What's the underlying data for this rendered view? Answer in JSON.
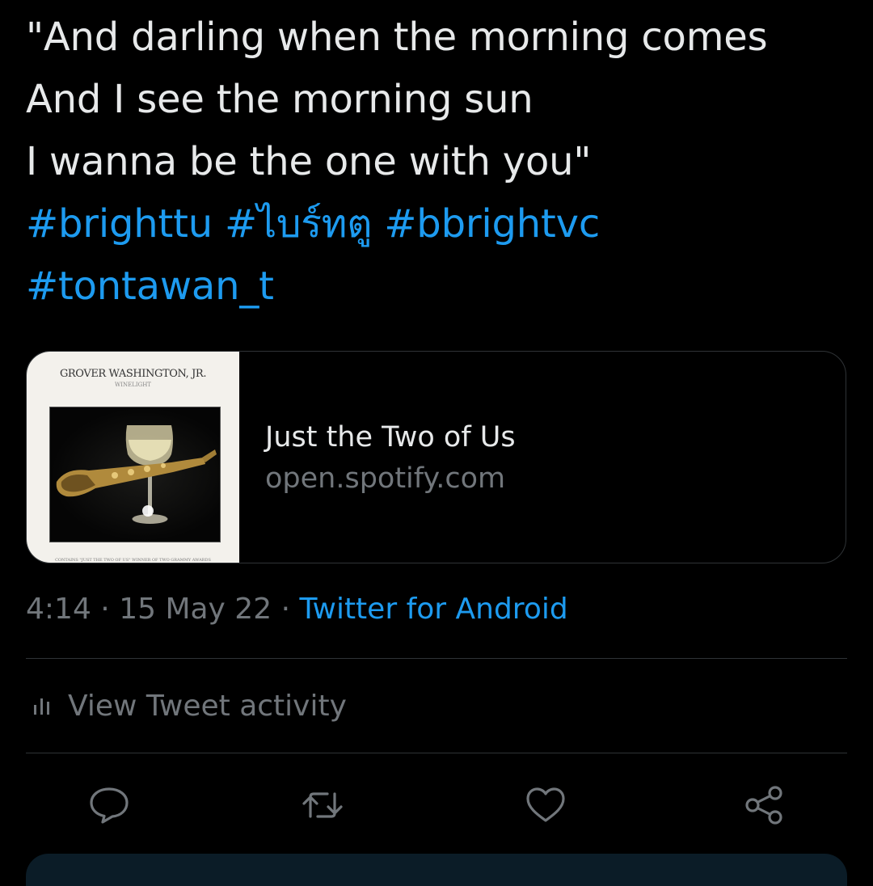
{
  "tweet": {
    "lines": [
      "\"And darling when the morning comes",
      "And I see the morning sun",
      "I wanna be the one with you\""
    ],
    "hashtags": [
      "#brighttu",
      "#ไบร์ทตู",
      "#bbrightvc",
      "#tontawan_t"
    ]
  },
  "card": {
    "album": {
      "artist": "GROVER WASHINGTON, JR.",
      "title": "WINELIGHT",
      "footer": "CONTAINS \"JUST THE TWO OF US\" WINNER OF TWO GRAMMY AWARDS"
    },
    "title": "Just the Two of Us",
    "domain": "open.spotify.com"
  },
  "meta": {
    "time": "4:14",
    "separator": " · ",
    "date": "15 May 22",
    "source": "Twitter for Android"
  },
  "activity": {
    "label": "View Tweet activity",
    "icon": "bar-chart-icon"
  },
  "actions": {
    "reply_icon": "reply-icon",
    "retweet_icon": "retweet-icon",
    "like_icon": "heart-icon",
    "share_icon": "share-icon"
  },
  "colors": {
    "background": "#000000",
    "text": "#e7e9ea",
    "secondary": "#71767b",
    "accent": "#1d9bf0",
    "border": "#2f3336"
  }
}
